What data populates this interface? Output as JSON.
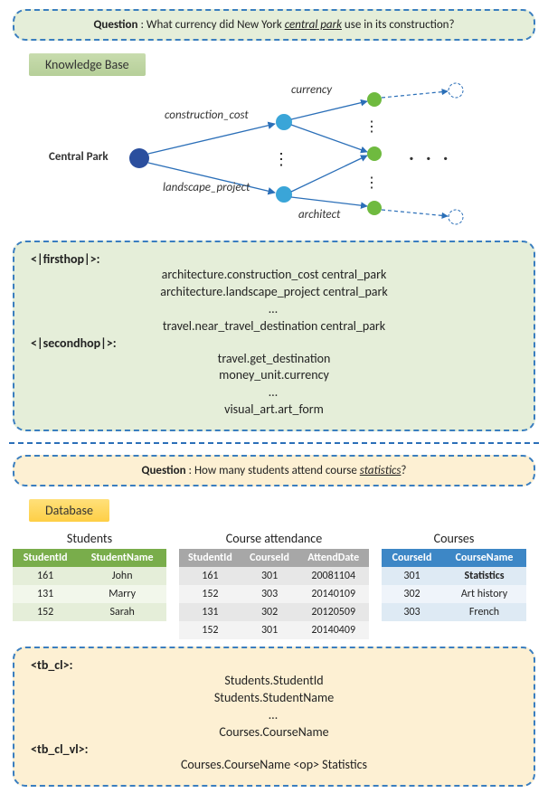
{
  "question1": {
    "label": "Question",
    "text_before": "What currency did New York ",
    "underlined": "central park",
    "text_after": " use in its construction?"
  },
  "kb_tag": "Knowledge Base",
  "kb_graph": {
    "root": "Central Park",
    "edges_multihop_L1": [
      "construction_cost",
      "landscape_project"
    ],
    "edges_multihop_L2": [
      "currency",
      "architect"
    ]
  },
  "kb_result": {
    "first_header": "<|firsthop|>:",
    "first_items": [
      "architecture.construction_cost  central_park",
      "architecture.landscape_project  central_park",
      "travel.near_travel_destination central_park"
    ],
    "second_header": "<|secondhop|>:",
    "second_items": [
      "travel.get_destination",
      "money_unit.currency",
      "visual_art.art_form"
    ]
  },
  "question2": {
    "label": "Question",
    "text_before": "How many students attend course ",
    "underlined": "statistics",
    "text_after": "?"
  },
  "db_tag": "Database",
  "tables": {
    "students": {
      "caption": "Students",
      "cols": [
        "StudentId",
        "StudentName"
      ],
      "rows": [
        [
          "161",
          "John"
        ],
        [
          "131",
          "Marry"
        ],
        [
          "152",
          "Sarah"
        ]
      ]
    },
    "attendance": {
      "caption": "Course attendance",
      "cols": [
        "StudentId",
        "CourseId",
        "AttendDate"
      ],
      "rows": [
        [
          "161",
          "301",
          "20081104"
        ],
        [
          "152",
          "303",
          "20140109"
        ],
        [
          "131",
          "302",
          "20120509"
        ],
        [
          "152",
          "301",
          "20140409"
        ]
      ]
    },
    "courses": {
      "caption": "Courses",
      "cols": [
        "CourseId",
        "CourseName"
      ],
      "rows": [
        [
          "301",
          "Statistics"
        ],
        [
          "302",
          "Art history"
        ],
        [
          "303",
          "French"
        ]
      ]
    }
  },
  "db_result": {
    "tbcl_header": "<tb_cl>:",
    "tbcl_items": [
      "Students.StudentId",
      "Students.StudentName",
      "Courses.CourseName"
    ],
    "tbclvl_header": "<tb_cl_vl>:",
    "tbclvl_items": [
      "Courses.CourseName <op> Statistics"
    ]
  }
}
